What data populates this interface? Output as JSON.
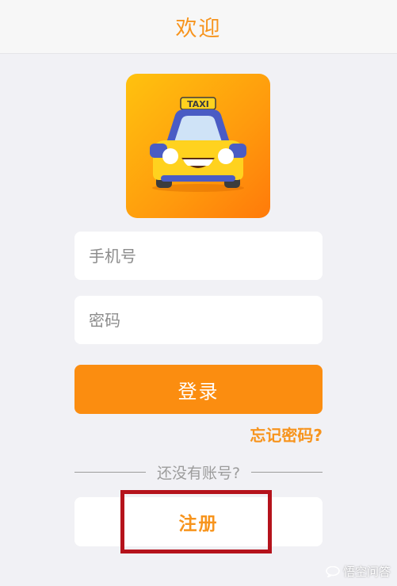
{
  "header": {
    "title": "欢迎"
  },
  "logo": {
    "icon": "taxi-icon",
    "sign_text": "TAXI"
  },
  "form": {
    "phone_placeholder": "手机号",
    "password_placeholder": "密码",
    "login_label": "登录",
    "forgot_label": "忘记密码?"
  },
  "signup": {
    "prompt": "还没有账号?",
    "register_label": "注册"
  },
  "watermark": {
    "text": "悟空问答"
  },
  "colors": {
    "accent": "#f7941d",
    "button": "#fb8d10",
    "background": "#f1f1f5",
    "highlight": "#b5131c"
  }
}
